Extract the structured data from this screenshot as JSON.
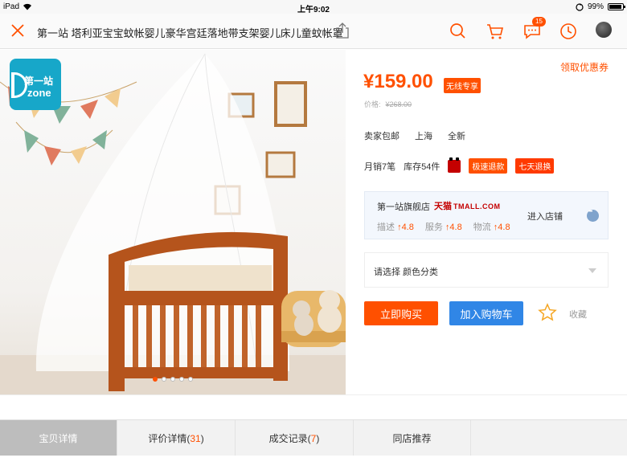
{
  "status_bar": {
    "device": "iPad",
    "time": "上午9:02",
    "battery": "99%"
  },
  "nav": {
    "title": "第一站 塔利亚宝宝蚊帐婴儿豪华宫廷落地带支架婴儿床儿童蚊帐罩",
    "message_badge": "15"
  },
  "hero": {
    "logo_top": "第一站",
    "logo_bottom": "zone",
    "slide_index": 1,
    "slide_count": 5
  },
  "product": {
    "price": "¥159.00",
    "price_tag": "无线专享",
    "coupon": "领取优惠券",
    "orig_label": "价格:",
    "orig_price": "¥268.00",
    "shipping": "卖家包邮",
    "location": "上海",
    "condition": "全新",
    "monthly_sales": "月销7笔",
    "stock": "库存54件",
    "promise_tag1": "极速退款",
    "promise_tag2": "七天退换"
  },
  "shop": {
    "name": "第一站旗舰店",
    "tmall_cn": "天猫",
    "tmall_en": "TMALL.COM",
    "desc_label": "描述",
    "desc_score": "4.8",
    "service_label": "服务",
    "service_score": "4.8",
    "logistics_label": "物流",
    "logistics_score": "4.8",
    "enter_label": "进入店铺"
  },
  "select": {
    "label": "请选择 颜色分类"
  },
  "actions": {
    "buy": "立即购买",
    "cart": "加入购物车",
    "favorite": "收藏"
  },
  "tabs": [
    {
      "label": "宝贝详情",
      "count": ""
    },
    {
      "label": "评价详情",
      "count": "31"
    },
    {
      "label": "成交记录",
      "count": "7"
    },
    {
      "label": "同店推荐",
      "count": ""
    }
  ],
  "colors": {
    "accent": "#ff5000",
    "blue": "#3086e6",
    "tmall_red": "#c40000"
  },
  "icons": [
    "close-icon",
    "share-icon",
    "search-icon",
    "cart-icon",
    "message-icon",
    "history-icon",
    "star-icon"
  ]
}
